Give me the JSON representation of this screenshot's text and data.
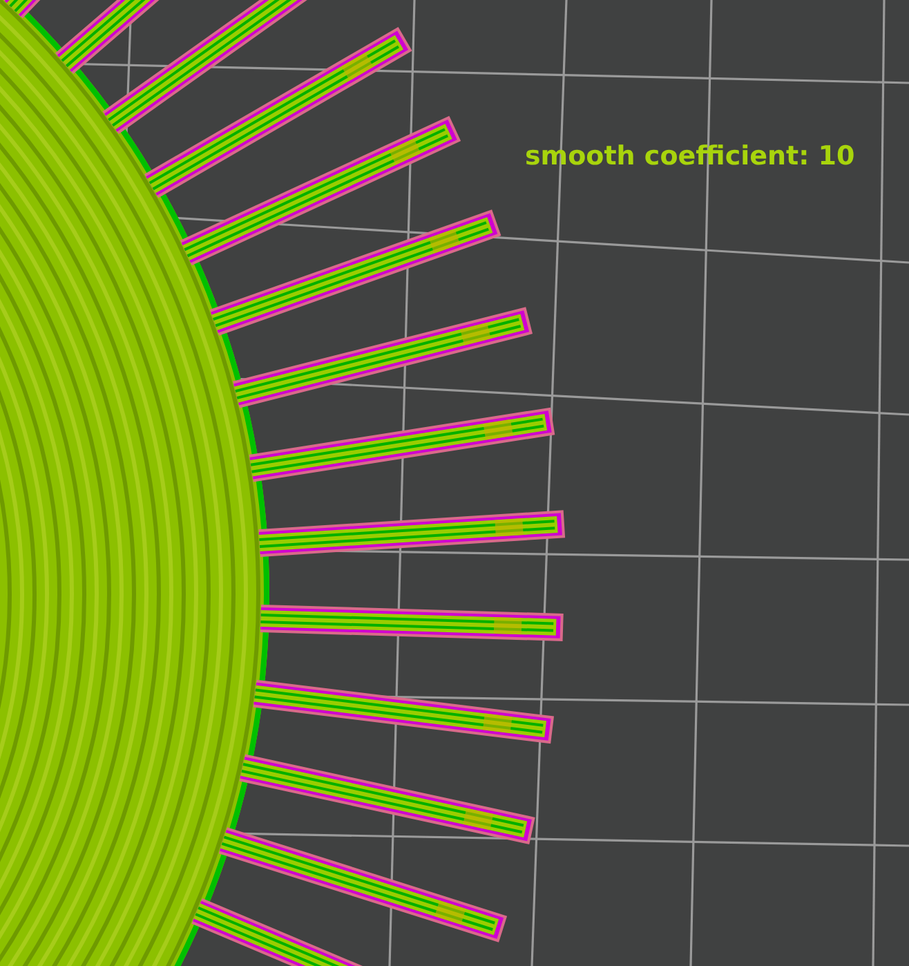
{
  "viewport": {
    "label": "smooth coefficient: 10"
  }
}
